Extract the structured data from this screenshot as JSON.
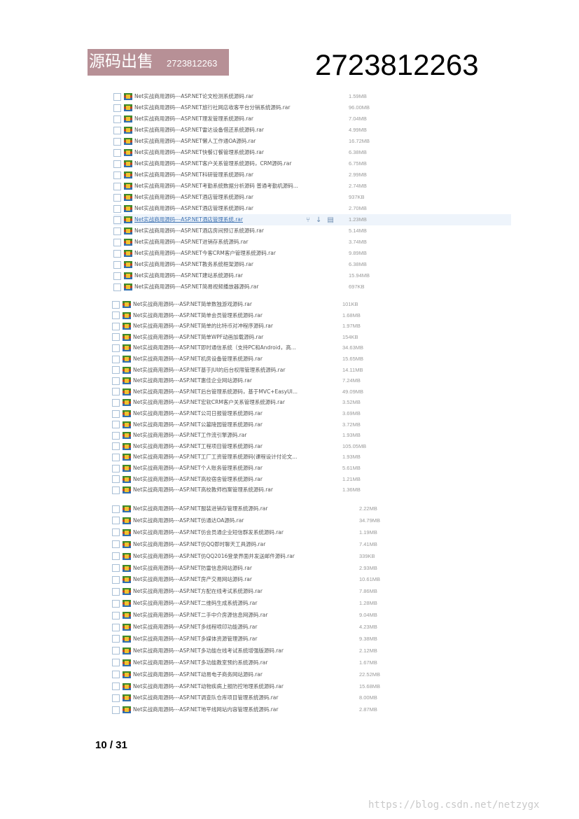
{
  "banner": {
    "title": "源码出售",
    "number": "2723812263"
  },
  "header_number": "2723812263",
  "groups": [
    {
      "rows": [
        {
          "name": "Net实战商用源码---ASP.NET论文检测系统源码.rar",
          "size": "1.59MB"
        },
        {
          "name": "Net实战商用源码---ASP.NET旅行社网店收客平台分销系统源码.rar",
          "size": "96.00MB"
        },
        {
          "name": "Net实战商用源码---ASP.NET理发管理系统源码.rar",
          "size": "7.04MB"
        },
        {
          "name": "Net实战商用源码---ASP.NET雷达设备借还系统源码.rar",
          "size": "4.99MB"
        },
        {
          "name": "Net实战商用源码---ASP.NET懒人工作通OA源码.rar",
          "size": "16.72MB"
        },
        {
          "name": "Net实战商用源码---ASP.NET快餐订餐管理系统源码.rar",
          "size": "6.38MB"
        },
        {
          "name": "Net实战商用源码---ASP.NET客户关系管理系统源码，CRM源码.rar",
          "size": "6.75MB"
        },
        {
          "name": "Net实战商用源码---ASP.NET科研管理系统源码.rar",
          "size": "2.99MB"
        },
        {
          "name": "Net实战商用源码---ASP.NET考勤系统数据分析源码 普通考勤机源码...",
          "size": "2.74MB"
        },
        {
          "name": "Net实战商用源码---ASP.NET酒店管理系统源码.rar",
          "size": "937KB"
        },
        {
          "name": "Net实战商用源码---ASP.NET酒店管理系统源码.rar",
          "size": "2.70MB"
        },
        {
          "name": "Net实战商用源码---ASP.NET酒店管理系统.rar",
          "size": "1.23MB"
        },
        {
          "name": "Net实战商用源码---ASP.NET酒店房间预订系统源码.rar",
          "size": "5.14MB"
        },
        {
          "name": "Net实战商用源码---ASP.NET进销存系统源码.rar",
          "size": "3.74MB"
        },
        {
          "name": "Net实战商用源码---ASP.NET今客CRM客户管理系统源码.rar",
          "size": "9.89MB"
        },
        {
          "name": "Net实战商用源码---ASP.NET教务系统框架源码.rar",
          "size": "6.38MB"
        },
        {
          "name": "Net实战商用源码---ASP.NET建站系统源码.rar",
          "size": "15.94MB"
        },
        {
          "name": "Net实战商用源码---ASP.NET简易视频播放器源码.rar",
          "size": "697KB"
        }
      ]
    },
    {
      "rows": [
        {
          "name": "Net实战商用源码---ASP.NET简单数独游戏源码.rar",
          "size": "101KB"
        },
        {
          "name": "Net实战商用源码---ASP.NET简单会员管理系统源码.rar",
          "size": "1.68MB"
        },
        {
          "name": "Net实战商用源码---ASP.NET简单的比特币对冲程序源码.rar",
          "size": "1.97MB"
        },
        {
          "name": "Net实战商用源码---ASP.NET简单WPF动画加载源码.rar",
          "size": "154KB"
        },
        {
          "name": "Net实战商用源码---ASP.NET即时通信系统（支持PC和Android，高...",
          "size": "34.63MB"
        },
        {
          "name": "Net实战商用源码---ASP.NET机房设备管理系统源码.rar",
          "size": "15.65MB"
        },
        {
          "name": "Net实战商用源码---ASP.NET基于JUI的后台权限管理系统源码.rar",
          "size": "14.11MB"
        },
        {
          "name": "Net实战商用源码---ASP.NET惠佳企业网站源码.rar",
          "size": "7.24MB"
        },
        {
          "name": "Net实战商用源码---ASP.NET后台管理系统源码，基于MVC+EasyUI...",
          "size": "49.09MB"
        },
        {
          "name": "Net实战商用源码---ASP.NET宏软CRM客户关系管理系统源码.rar",
          "size": "3.52MB"
        },
        {
          "name": "Net实战商用源码---ASP.NET公司日报管理系统源码.rar",
          "size": "3.69MB"
        },
        {
          "name": "Net实战商用源码---ASP.NET公墓陵园管理系统源码.rar",
          "size": "3.72MB"
        },
        {
          "name": "Net实战商用源码---ASP.NET工作流引擎源码.rar",
          "size": "1.93MB"
        },
        {
          "name": "Net实战商用源码---ASP.NET工程项目管理系统源码.rar",
          "size": "105.05MB"
        },
        {
          "name": "Net实战商用源码---ASP.NET工厂工资管理系统源码(课程设计付论文...",
          "size": "1.93MB"
        },
        {
          "name": "Net实战商用源码---ASP.NET个人账务管理系统源码.rar",
          "size": "5.61MB"
        },
        {
          "name": "Net实战商用源码---ASP.NET高校宿舍管理系统源码.rar",
          "size": "1.21MB"
        },
        {
          "name": "Net实战商用源码---ASP.NET高校教师档案管理系统源码.rar",
          "size": "1.36MB"
        }
      ]
    },
    {
      "rows": [
        {
          "name": "Net实战商用源码---ASP.NET服装进销存管理系统源码.rar",
          "size": "2.22MB"
        },
        {
          "name": "Net实战商用源码---ASP.NET仿通达OA源码.rar",
          "size": "34.79MB"
        },
        {
          "name": "Net实战商用源码---ASP.NET仿会员通企业短信群发系统源码.rar",
          "size": "1.19MB"
        },
        {
          "name": "Net实战商用源码---ASP.NET仿QQ即时聊天工具源码.rar",
          "size": "7.41MB"
        },
        {
          "name": "Net实战商用源码---ASP.NET仿QQ2016登录界面并发送邮件源码.rar",
          "size": "339KB"
        },
        {
          "name": "Net实战商用源码---ASP.NET防雷信息网站源码.rar",
          "size": "2.93MB"
        },
        {
          "name": "Net实战商用源码---ASP.NET房产交易网站源码.rar",
          "size": "10.61MB"
        },
        {
          "name": "Net实战商用源码---ASP.NET方配在线考试系统源码.rar",
          "size": "7.86MB"
        },
        {
          "name": "Net实战商用源码---ASP.NET二维码生成系统源码.rar",
          "size": "1.28MB"
        },
        {
          "name": "Net实战商用源码---ASP.NET二手中介房源信息网源码.rar",
          "size": "9.04MB"
        },
        {
          "name": "Net实战商用源码---ASP.NET多线程喷印功能源码.rar",
          "size": "4.23MB"
        },
        {
          "name": "Net实战商用源码---ASP.NET多媒体资源管理源码.rar",
          "size": "9.38MB"
        },
        {
          "name": "Net实战商用源码---ASP.NET多功能在线考试系统增强版源码.rar",
          "size": "2.12MB"
        },
        {
          "name": "Net实战商用源码---ASP.NET多功能教室预约系统源码.rar",
          "size": "1.67MB"
        },
        {
          "name": "Net实战商用源码---ASP.NET动易电子商务网站源码.rar",
          "size": "22.52MB"
        },
        {
          "name": "Net实战商用源码---ASP.NET动物疾病上报防控地理系统源码.rar",
          "size": "15.68MB"
        },
        {
          "name": "Net实战商用源码---ASP.NET调查队仓库项目管理系统源码.rar",
          "size": "8.00MB"
        },
        {
          "name": "Net实战商用源码---ASP.NET地平线网站内容管理系统源码.rar",
          "size": "2.87MB"
        }
      ]
    }
  ],
  "row_actions": {
    "share_icon": "share-icon",
    "download_icon": "download-icon",
    "delete_icon": "trash-icon"
  },
  "page_indicator": "10 / 31",
  "watermark": "https://blog.csdn.net/netzygx"
}
